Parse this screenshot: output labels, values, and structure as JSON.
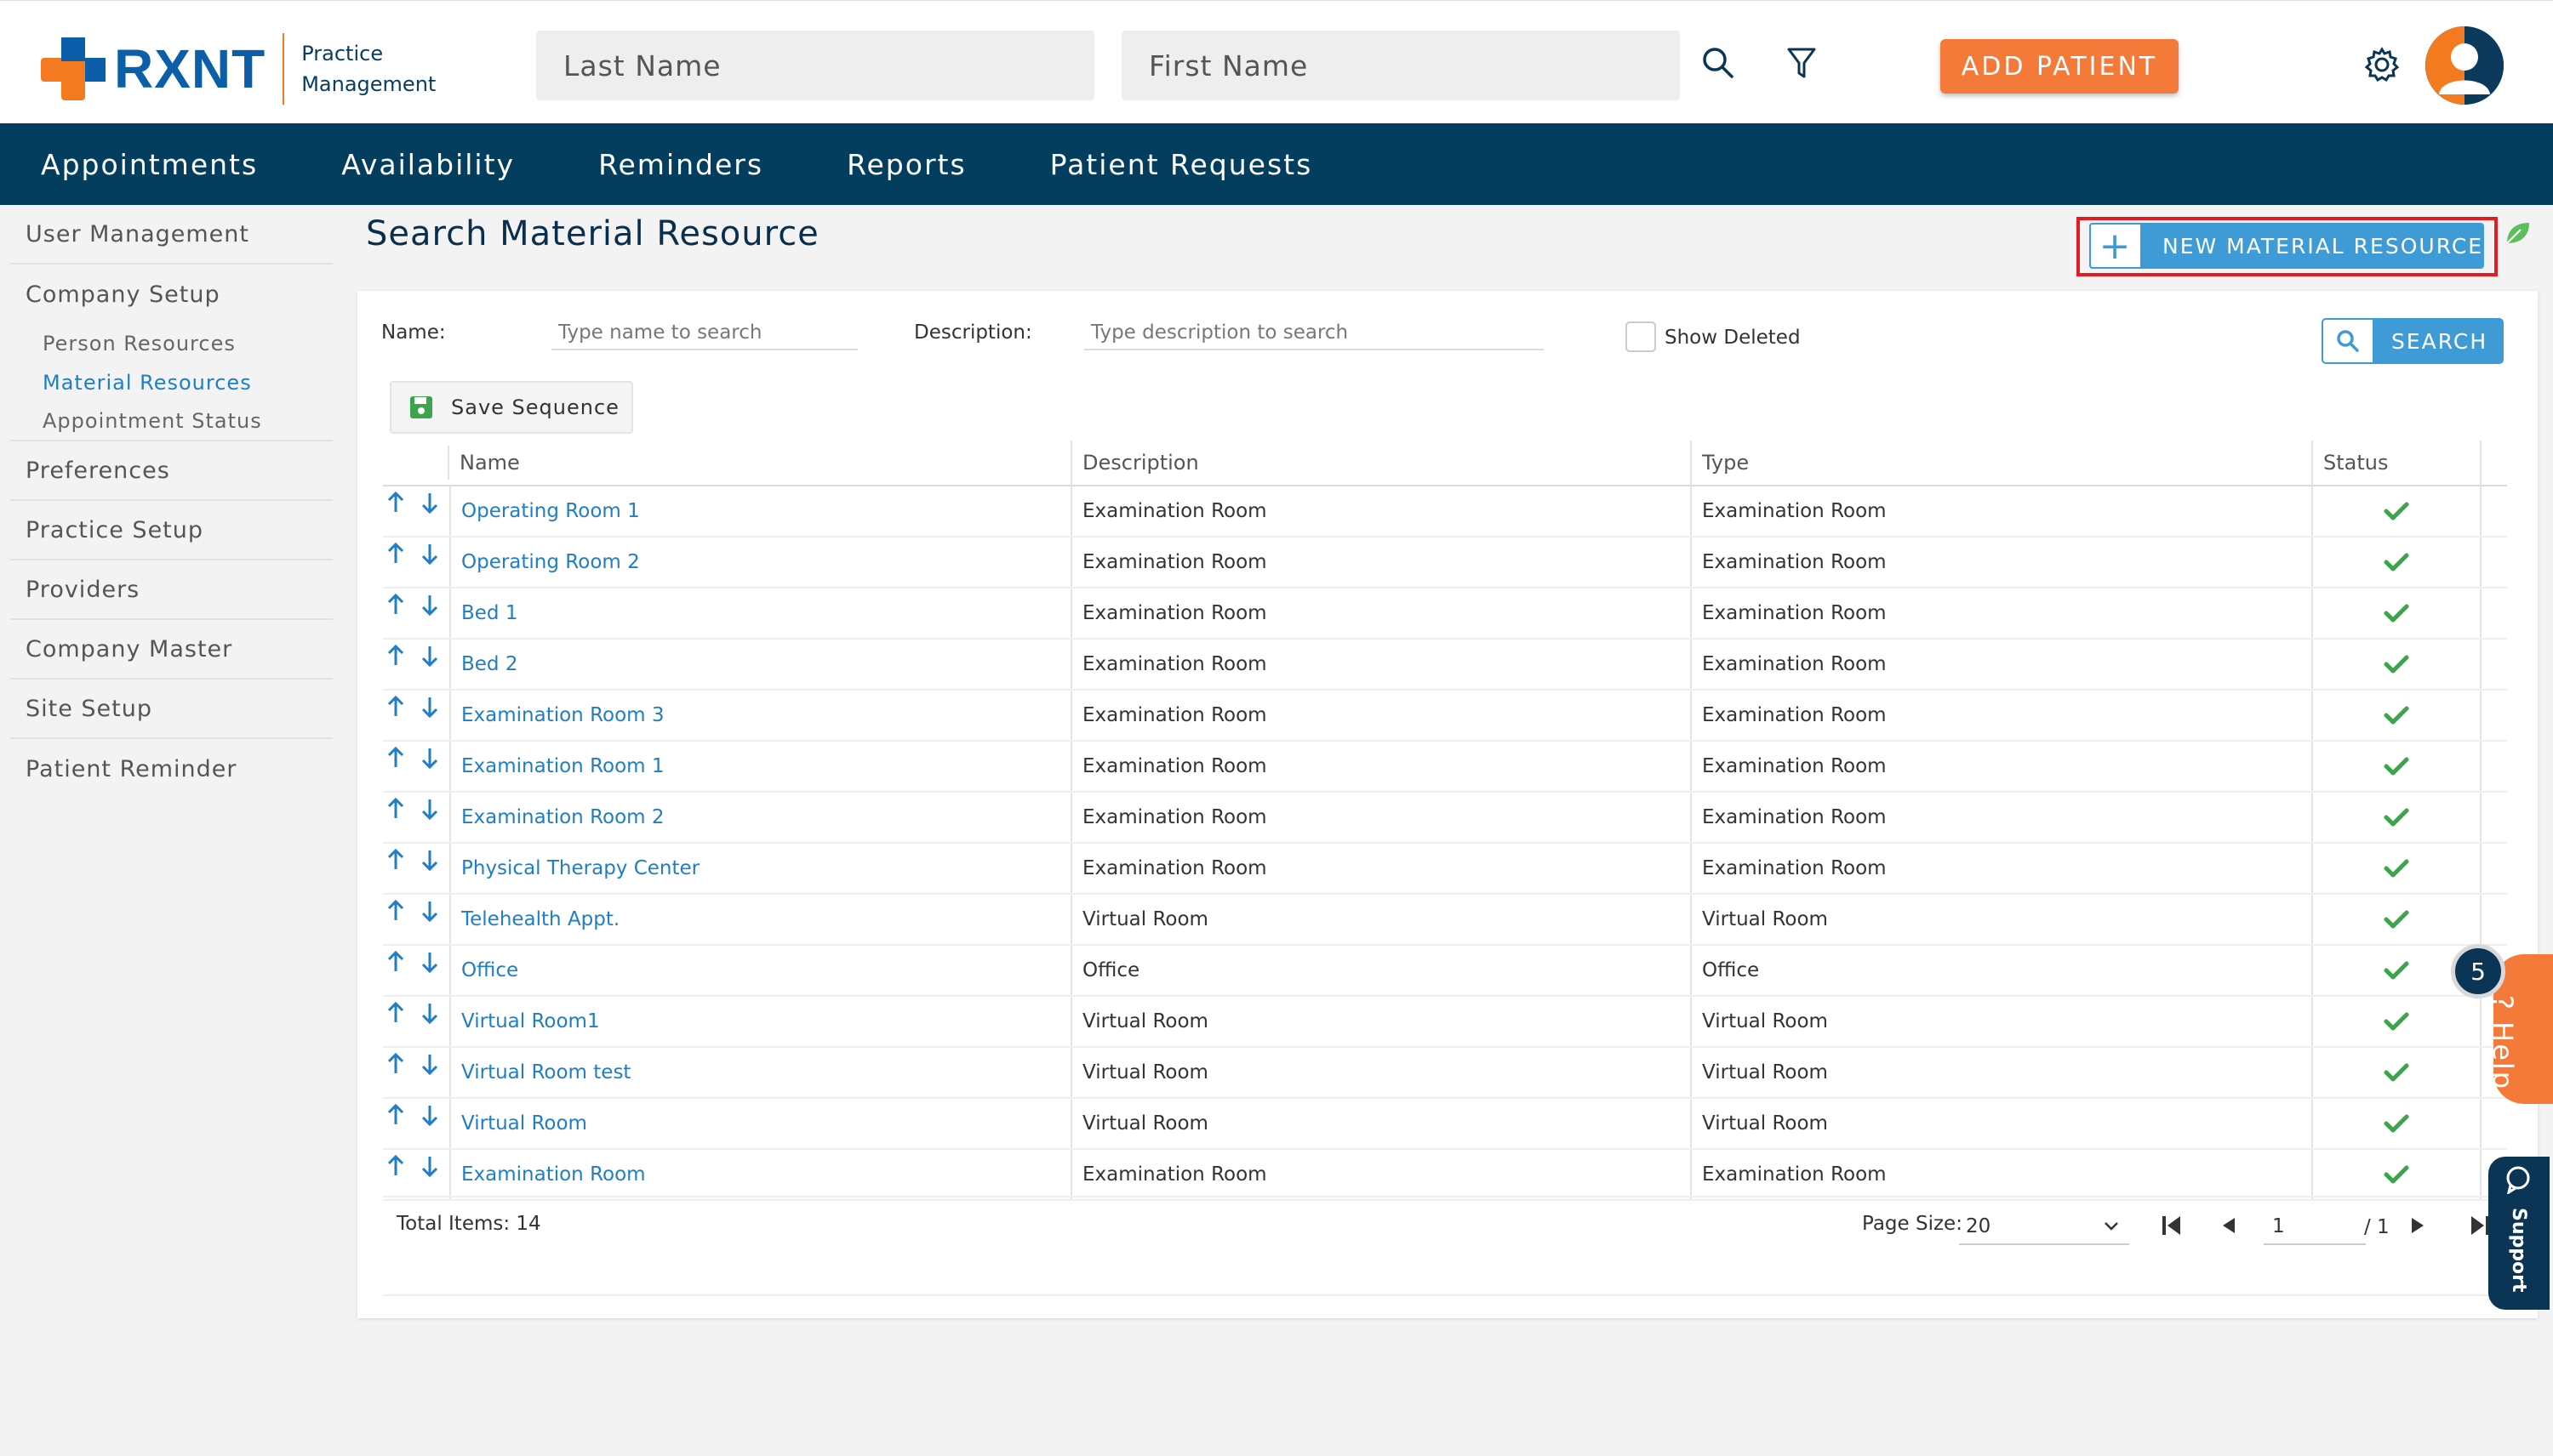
{
  "header": {
    "brand": "RXNT",
    "brand_sub_line1": "Practice",
    "brand_sub_line2": "Management",
    "last_name_placeholder": "Last Name",
    "first_name_placeholder": "First Name",
    "add_patient_label": "ADD PATIENT",
    "colors": {
      "brand_blue": "#0b5ea8",
      "brand_orange": "#f47a20",
      "nav_bg": "#033e5e",
      "accent": "#3e9bd6"
    }
  },
  "nav": {
    "items": [
      {
        "label": "Appointments"
      },
      {
        "label": "Availability"
      },
      {
        "label": "Reminders"
      },
      {
        "label": "Reports"
      },
      {
        "label": "Patient Requests"
      }
    ]
  },
  "sidebar": {
    "user_management": "User Management",
    "company_setup": "Company Setup",
    "sub": [
      {
        "label": "Person Resources"
      },
      {
        "label": "Material Resources"
      },
      {
        "label": "Appointment Status"
      }
    ],
    "items": [
      {
        "label": "Preferences"
      },
      {
        "label": "Practice Setup"
      },
      {
        "label": "Providers"
      },
      {
        "label": "Company Master"
      },
      {
        "label": "Site Setup"
      },
      {
        "label": "Patient Reminder"
      }
    ]
  },
  "main": {
    "title": "Search Material Resource",
    "new_resource_label": "NEW MATERIAL RESOURCE",
    "filters": {
      "name_label": "Name:",
      "name_placeholder": "Type name to search",
      "description_label": "Description:",
      "description_placeholder": "Type description to search",
      "show_deleted_label": "Show Deleted",
      "search_label": "SEARCH"
    },
    "save_sequence_label": "Save Sequence",
    "table": {
      "headers": {
        "name": "Name",
        "description": "Description",
        "type": "Type",
        "status": "Status"
      },
      "rows": [
        {
          "name": "Operating Room 1",
          "description": "Examination Room",
          "type": "Examination Room",
          "status": "active"
        },
        {
          "name": "Operating Room 2",
          "description": "Examination Room",
          "type": "Examination Room",
          "status": "active"
        },
        {
          "name": "Bed 1",
          "description": "Examination Room",
          "type": "Examination Room",
          "status": "active"
        },
        {
          "name": "Bed 2",
          "description": "Examination Room",
          "type": "Examination Room",
          "status": "active"
        },
        {
          "name": "Examination Room 3",
          "description": "Examination Room",
          "type": "Examination Room",
          "status": "active"
        },
        {
          "name": "Examination Room 1",
          "description": "Examination Room",
          "type": "Examination Room",
          "status": "active"
        },
        {
          "name": "Examination Room 2",
          "description": "Examination Room",
          "type": "Examination Room",
          "status": "active"
        },
        {
          "name": "Physical Therapy Center",
          "description": "Examination Room",
          "type": "Examination Room",
          "status": "active"
        },
        {
          "name": "Telehealth Appt.",
          "description": "Virtual Room",
          "type": "Virtual Room",
          "status": "active"
        },
        {
          "name": "Office",
          "description": "Office",
          "type": "Office",
          "status": "active"
        },
        {
          "name": "Virtual Room1",
          "description": "Virtual Room",
          "type": "Virtual Room",
          "status": "active"
        },
        {
          "name": "Virtual Room test",
          "description": "Virtual Room",
          "type": "Virtual Room",
          "status": "active"
        },
        {
          "name": "Virtual Room",
          "description": "Virtual Room",
          "type": "Virtual Room",
          "status": "active"
        },
        {
          "name": "Examination Room",
          "description": "Examination Room",
          "type": "Examination Room",
          "status": "active"
        }
      ]
    },
    "footer": {
      "total_items": "Total Items: 14",
      "page_size_label": "Page Size:",
      "page_size_value": "20",
      "current_page": "1",
      "total_pages": "/ 1"
    }
  },
  "widgets": {
    "help_badge": "5",
    "help_label": "Help",
    "help_q": "?",
    "support_label": "Support"
  }
}
